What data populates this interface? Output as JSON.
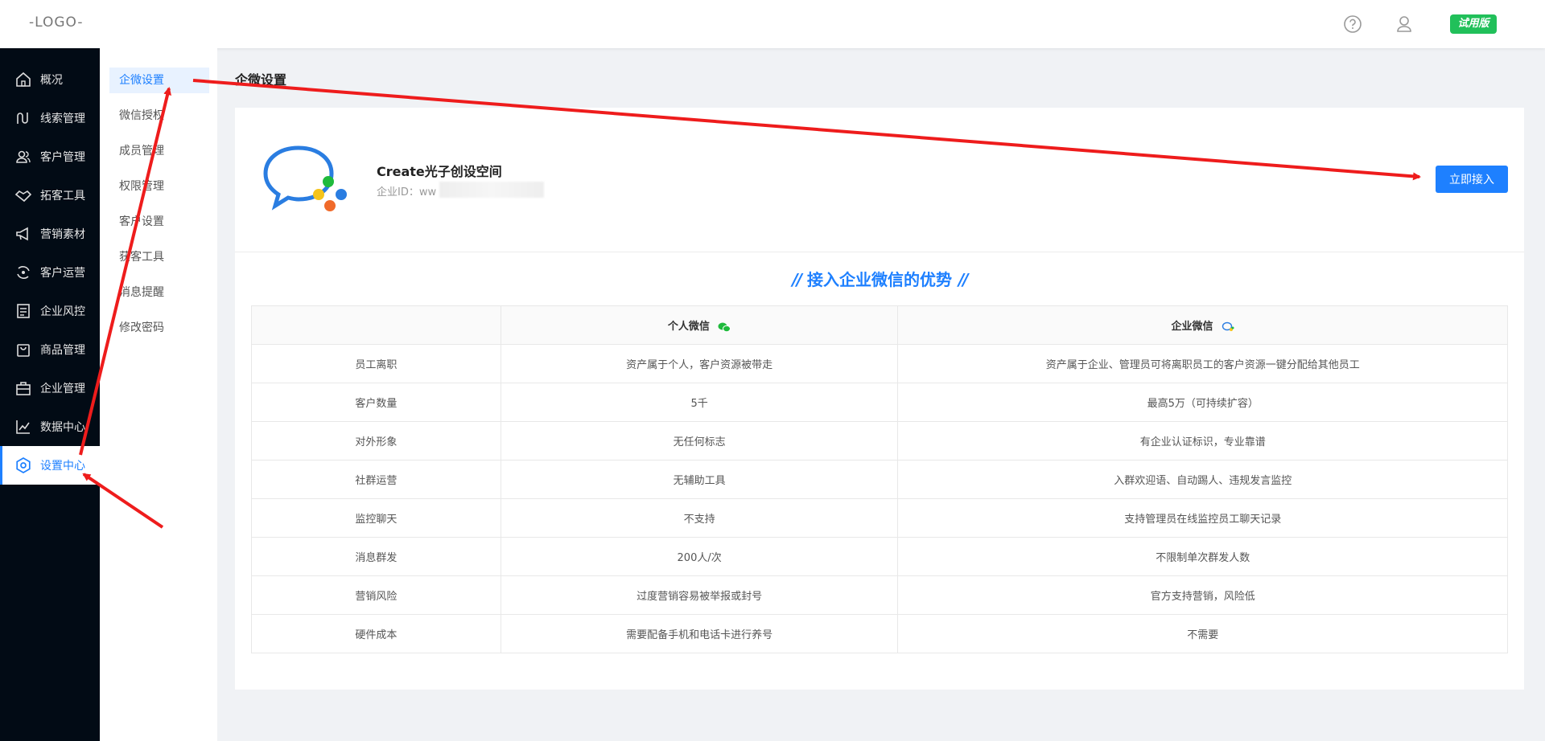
{
  "header": {
    "logo": "-LOGO-",
    "help_icon": "question-circle-icon",
    "user_icon": "user-icon",
    "trial_badge": "试用版"
  },
  "sidebar": {
    "items": [
      {
        "label": "概况",
        "icon": "home-icon"
      },
      {
        "label": "线索管理",
        "icon": "route-icon"
      },
      {
        "label": "客户管理",
        "icon": "users-icon"
      },
      {
        "label": "拓客工具",
        "icon": "handshake-icon"
      },
      {
        "label": "营销素材",
        "icon": "megaphone-icon"
      },
      {
        "label": "客户运营",
        "icon": "cycle-icon"
      },
      {
        "label": "企业风控",
        "icon": "document-icon"
      },
      {
        "label": "商品管理",
        "icon": "shopping-bag-icon"
      },
      {
        "label": "企业管理",
        "icon": "briefcase-icon"
      },
      {
        "label": "数据中心",
        "icon": "chart-line-icon"
      },
      {
        "label": "设置中心",
        "icon": "gear-icon",
        "active": true
      }
    ]
  },
  "submenu": {
    "items": [
      {
        "label": "企微设置",
        "active": true
      },
      {
        "label": "微信授权"
      },
      {
        "label": "成员管理"
      },
      {
        "label": "权限管理"
      },
      {
        "label": "客户设置"
      },
      {
        "label": "获客工具"
      },
      {
        "label": "消息提醒"
      },
      {
        "label": "修改密码"
      }
    ]
  },
  "main": {
    "page_title": "企微设置",
    "corp": {
      "name": "Create光子创设空间",
      "id_label": "企业ID：ww",
      "connect_button": "立即接入"
    },
    "advantage_title": "接入企业微信的优势",
    "table": {
      "headers": [
        "",
        "个人微信",
        "企业微信"
      ],
      "rows": [
        [
          "员工离职",
          "资产属于个人，客户资源被带走",
          "资产属于企业、管理员可将离职员工的客户资源一键分配给其他员工"
        ],
        [
          "客户数量",
          "5千",
          "最高5万（可持续扩容）"
        ],
        [
          "对外形象",
          "无任何标志",
          "有企业认证标识，专业靠谱"
        ],
        [
          "社群运营",
          "无辅助工具",
          "入群欢迎语、自动踢人、违规发言监控"
        ],
        [
          "监控聊天",
          "不支持",
          "支持管理员在线监控员工聊天记录"
        ],
        [
          "消息群发",
          "200人/次",
          "不限制单次群发人数"
        ],
        [
          "营销风险",
          "过度营销容易被举报或封号",
          "官方支持营销，风险低"
        ],
        [
          "硬件成本",
          "需要配备手机和电话卡进行养号",
          "不需要"
        ]
      ]
    }
  },
  "colors": {
    "accent": "#1e80ff",
    "sidebar_bg": "#020b15",
    "trial_badge": "#21c05a",
    "annotation_arrow": "#ee1c1c"
  }
}
